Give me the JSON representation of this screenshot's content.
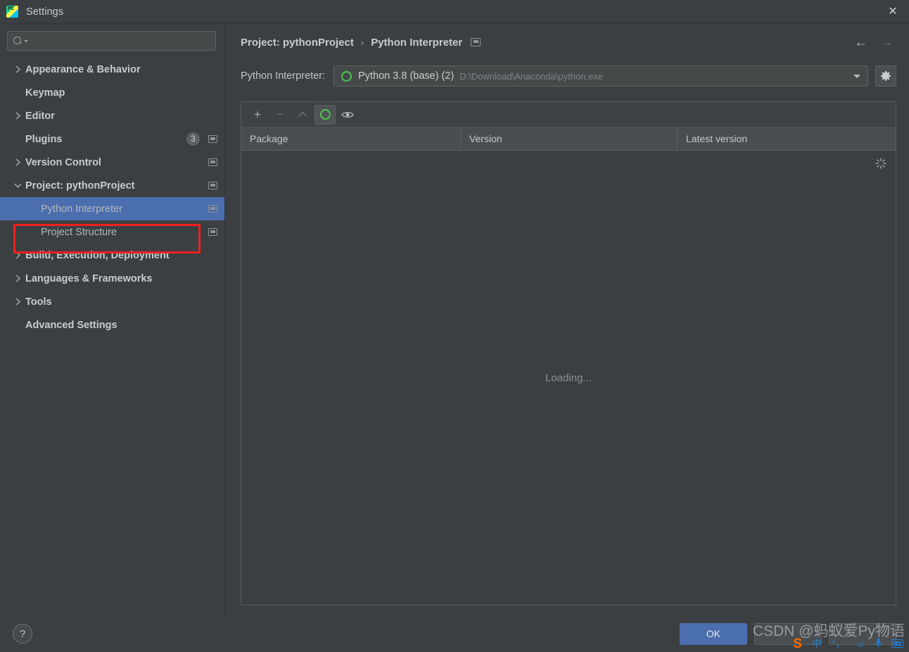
{
  "window": {
    "title": "Settings",
    "app_icon": "pycharm-icon",
    "close_icon": "close-icon"
  },
  "search": {
    "value": "",
    "placeholder": "",
    "icon": "search-icon"
  },
  "sidebar": {
    "items": [
      {
        "label": "Appearance & Behavior",
        "level": 0,
        "arrow": "chevron-right",
        "bold": true,
        "badge": "",
        "monitor": false
      },
      {
        "label": "Keymap",
        "level": 0,
        "arrow": "none",
        "bold": true,
        "badge": "",
        "monitor": false
      },
      {
        "label": "Editor",
        "level": 0,
        "arrow": "chevron-right",
        "bold": true,
        "badge": "",
        "monitor": false
      },
      {
        "label": "Plugins",
        "level": 0,
        "arrow": "none",
        "bold": true,
        "badge": "3",
        "monitor": true
      },
      {
        "label": "Version Control",
        "level": 0,
        "arrow": "chevron-right",
        "bold": true,
        "badge": "",
        "monitor": true
      },
      {
        "label": "Project: pythonProject",
        "level": 0,
        "arrow": "chevron-down",
        "bold": true,
        "badge": "",
        "monitor": true
      },
      {
        "label": "Python Interpreter",
        "level": 1,
        "arrow": "none",
        "bold": false,
        "badge": "",
        "monitor": true,
        "selected": true
      },
      {
        "label": "Project Structure",
        "level": 1,
        "arrow": "none",
        "bold": false,
        "badge": "",
        "monitor": true
      },
      {
        "label": "Build, Execution, Deployment",
        "level": 0,
        "arrow": "chevron-right",
        "bold": true,
        "badge": "",
        "monitor": false
      },
      {
        "label": "Languages & Frameworks",
        "level": 0,
        "arrow": "chevron-right",
        "bold": true,
        "badge": "",
        "monitor": false
      },
      {
        "label": "Tools",
        "level": 0,
        "arrow": "chevron-right",
        "bold": true,
        "badge": "",
        "monitor": false
      },
      {
        "label": "Advanced Settings",
        "level": 0,
        "arrow": "none",
        "bold": true,
        "badge": "",
        "monitor": false
      }
    ],
    "highlight_color": "#ef2020",
    "selection_color": "#4b6eaf"
  },
  "header": {
    "breadcrumb_parent": "Project: pythonProject",
    "breadcrumb_sep": "›",
    "breadcrumb_current": "Python Interpreter",
    "back_icon": "arrow-left-icon",
    "forward_icon": "arrow-right-icon",
    "back_glyph": "←",
    "forward_glyph": "→"
  },
  "interpreter": {
    "label": "Python Interpreter:",
    "name": "Python 3.8 (base) (2)",
    "path": "D:\\Download\\Anaconda\\python.exe",
    "icon": "conda-env-icon",
    "dropdown_icon": "chevron-down-icon",
    "gear_icon": "gear-icon"
  },
  "packages": {
    "toolbar": [
      {
        "name": "add-package-button",
        "glyph": "+",
        "state": "enabled"
      },
      {
        "name": "remove-package-button",
        "glyph": "−",
        "state": "disabled"
      },
      {
        "name": "upgrade-package-button",
        "glyph": "▲",
        "state": "disabled"
      },
      {
        "name": "conda-refresh-button",
        "glyph": "",
        "state": "active"
      },
      {
        "name": "show-early-releases-button",
        "glyph": "◉",
        "state": "enabled"
      }
    ],
    "columns": [
      "Package",
      "Version",
      "Latest version"
    ],
    "rows": [],
    "loading_text": "Loading...",
    "spinner_icon": "loading-spinner-icon"
  },
  "footer": {
    "help_label": "?",
    "buttons": [
      {
        "label": "OK",
        "primary": true,
        "name": "ok-button"
      },
      {
        "label": "",
        "primary": false,
        "name": "cancel-button"
      },
      {
        "label": "",
        "primary": false,
        "name": "apply-button"
      }
    ]
  },
  "overlay": {
    "watermark": "CSDN @蚂蚁爱Py物语",
    "ime": {
      "logo": "S",
      "mode": "中",
      "punctuation": "°，",
      "emoji": "☺",
      "mic": "⬤",
      "keyboard": "keyboard-icon"
    }
  }
}
